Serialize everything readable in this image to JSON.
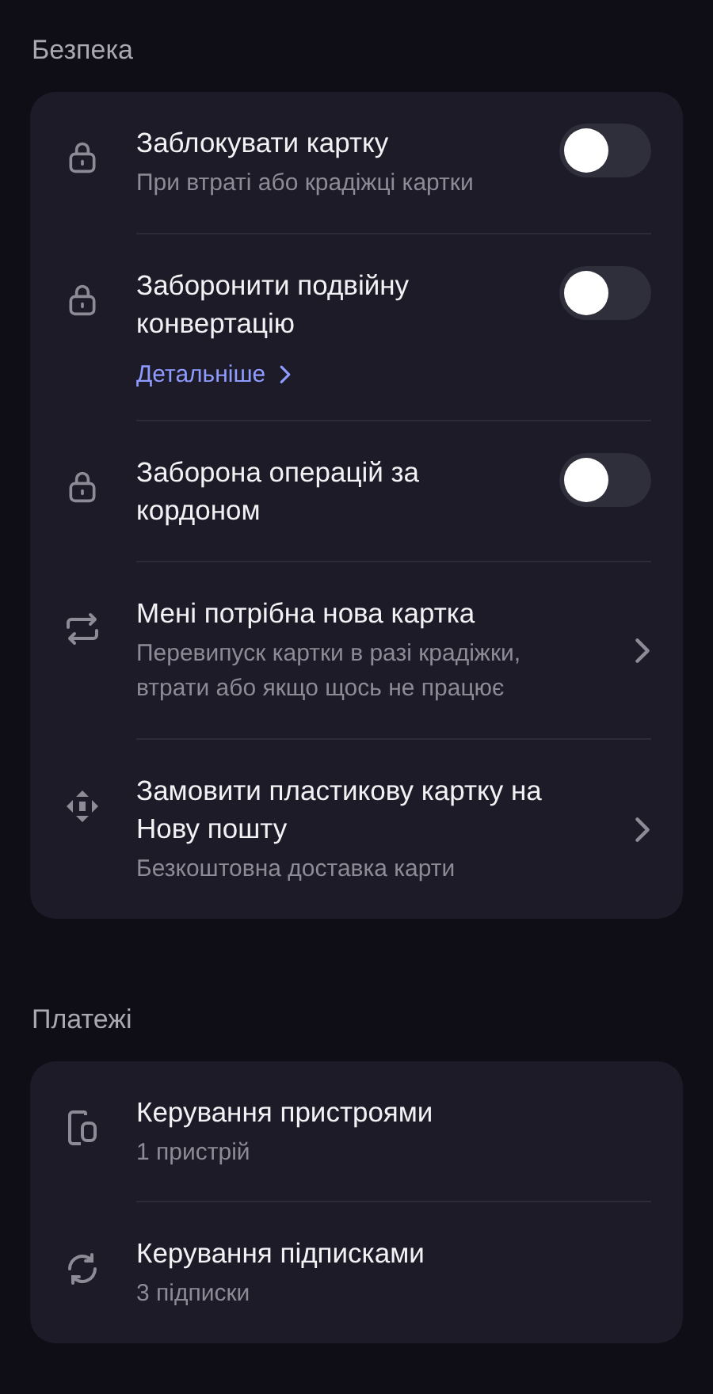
{
  "sections": [
    {
      "title": "Безпека",
      "items": [
        {
          "kind": "toggle",
          "title": "Заблокувати картку",
          "subtitle": "При втраті або крадіжці картки",
          "on": false
        },
        {
          "kind": "toggle",
          "title": "Заборонити подвійну конвертацію",
          "link": "Детальніше",
          "on": false
        },
        {
          "kind": "toggle",
          "title": "Заборона операцій за кордоном",
          "on": false
        },
        {
          "kind": "nav",
          "title": "Мені потрібна нова картка",
          "subtitle": "Перевипуск картки в разі крадіжки, втрати або якщо щось не працює"
        },
        {
          "kind": "nav",
          "title": "Замовити пластикову картку на Нову пошту",
          "subtitle": "Безкоштовна доставка карти"
        }
      ]
    },
    {
      "title": "Платежі",
      "items": [
        {
          "kind": "plain",
          "title": "Керування пристроями",
          "subtitle": "1 пристрій"
        },
        {
          "kind": "plain",
          "title": "Керування підписками",
          "subtitle": "3 підписки"
        }
      ]
    }
  ]
}
